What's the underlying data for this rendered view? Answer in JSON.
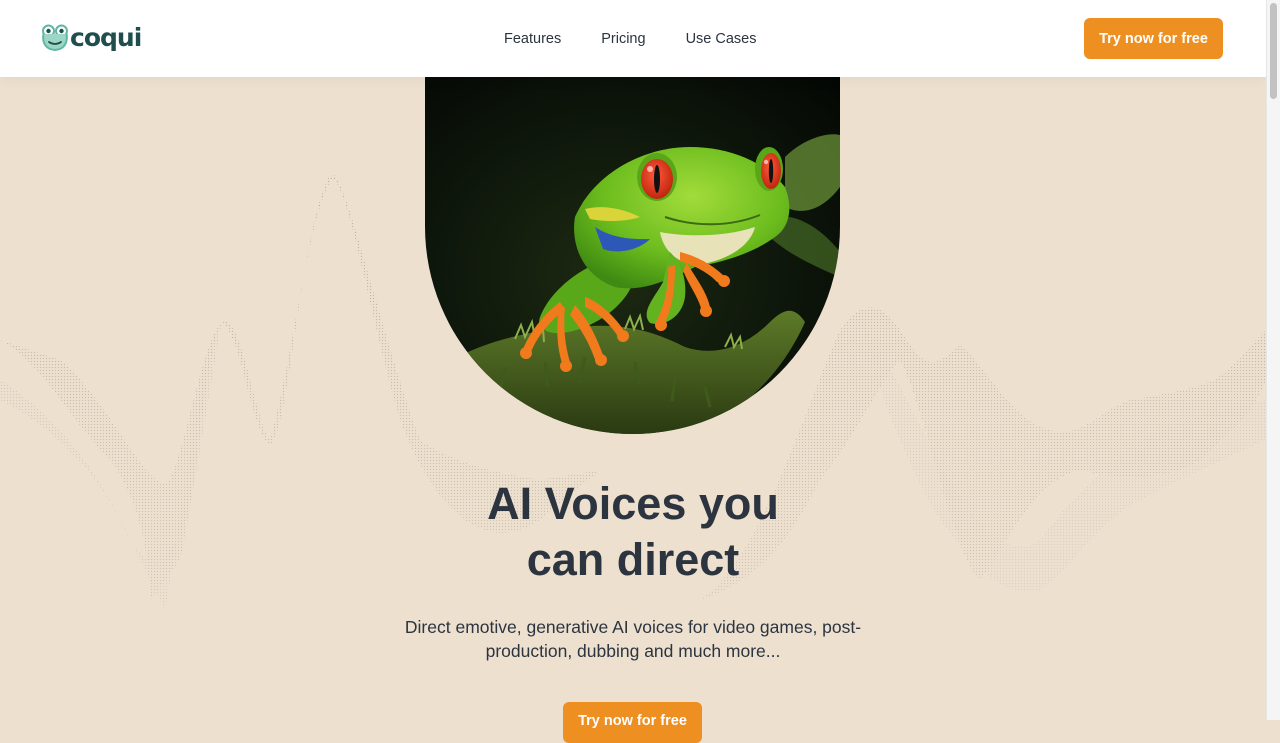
{
  "header": {
    "logo_text": "coqui",
    "logo_icon": "frog-logo-icon",
    "nav": [
      {
        "label": "Features"
      },
      {
        "label": "Pricing"
      },
      {
        "label": "Use Cases"
      }
    ],
    "cta_label": "Try now for free"
  },
  "hero": {
    "image": "red-eyed-tree-frog-photo",
    "headline_line1": "AI Voices you",
    "headline_line2": "can direct",
    "subtitle": "Direct emotive, generative AI voices for video games, post-production, dubbing and much more...",
    "cta_label": "Try now for free"
  },
  "colors": {
    "background": "#ede0cf",
    "accent": "#ee8f22",
    "brand": "#1f4e4d",
    "text": "#2c3440"
  }
}
